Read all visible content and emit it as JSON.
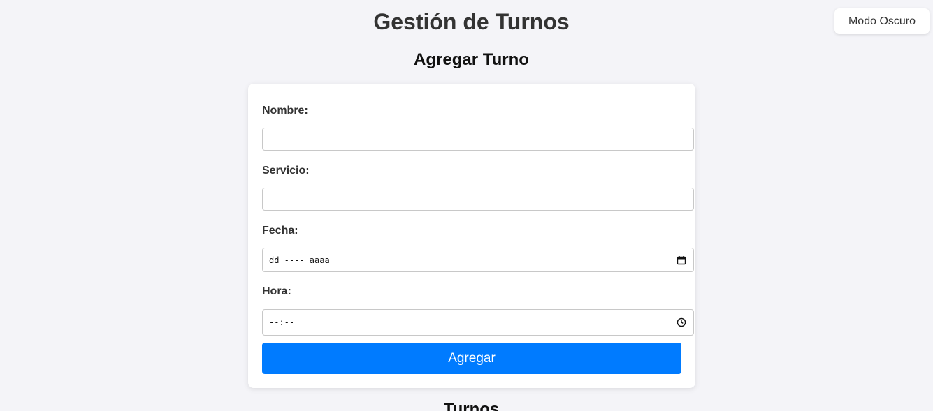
{
  "header": {
    "title": "Gestión de Turnos",
    "dark_mode_label": "Modo Oscuro"
  },
  "form": {
    "title": "Agregar Turno",
    "name_label": "Nombre:",
    "name_value": "",
    "service_label": "Servicio:",
    "service_value": "",
    "date_label": "Fecha:",
    "date_placeholder": "dd ---- aaaa",
    "time_label": "Hora:",
    "time_placeholder": "--:--",
    "submit_label": "Agregar",
    "accent_color": "#007bff"
  },
  "list": {
    "title": "Turnos"
  },
  "icons": {
    "date_picker": "calendar-icon",
    "time_picker": "clock-icon"
  }
}
